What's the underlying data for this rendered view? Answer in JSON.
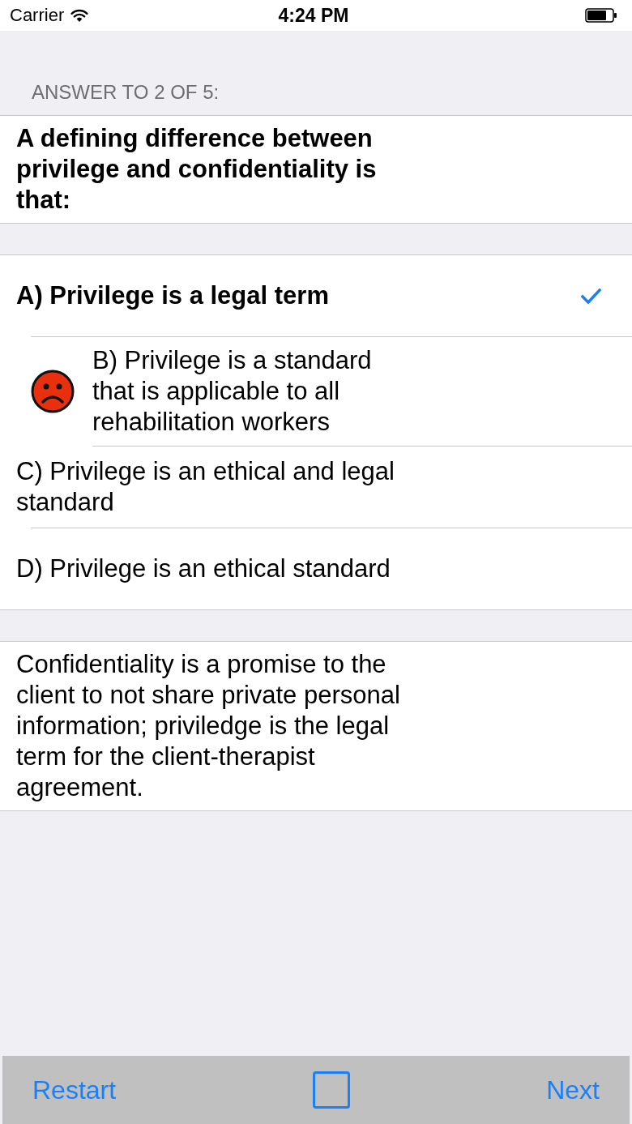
{
  "status_bar": {
    "carrier": "Carrier",
    "time": "4:24 PM"
  },
  "header": "ANSWER TO 2 OF 5:",
  "question": "A defining difference between privilege and confidentiality is that:",
  "options": [
    {
      "label": "A) Privilege is a legal term",
      "correct": true,
      "selected": false
    },
    {
      "label": "B) Privilege is a standard that is applicable to all rehabilitation workers",
      "correct": false,
      "selected": true
    },
    {
      "label": "C) Privilege is an ethical and legal standard",
      "correct": false,
      "selected": false
    },
    {
      "label": "D) Privilege is an ethical standard",
      "correct": false,
      "selected": false
    }
  ],
  "explanation": "Confidentiality is a promise to the client to not share private personal information; priviledge is the legal term for the client-therapist agreement.",
  "toolbar": {
    "restart": "Restart",
    "checkbox": {
      "checked": false
    },
    "next": "Next"
  }
}
